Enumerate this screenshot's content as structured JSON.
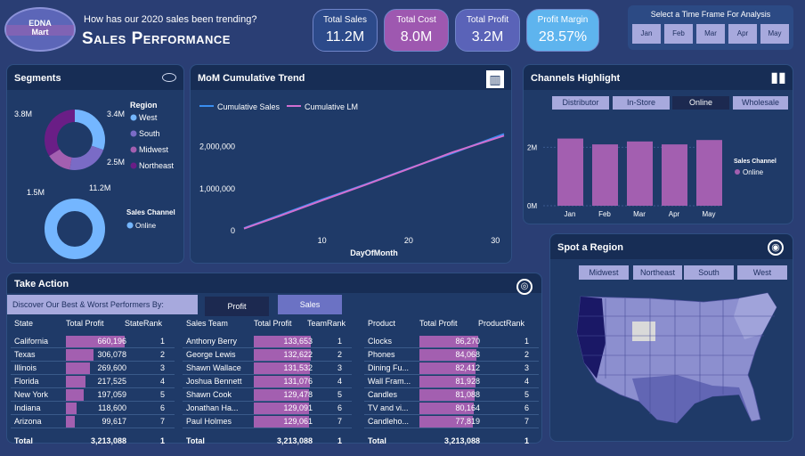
{
  "header": {
    "logo_line1": "EDNA",
    "logo_line2": "Mart",
    "question": "How has our 2020 sales been trending?",
    "title": "Sales Performance"
  },
  "kpis": [
    {
      "label": "Total Sales",
      "value": "11.2M",
      "color": "#2c4a8a"
    },
    {
      "label": "Total Cost",
      "value": "8.0M",
      "color": "#9e58b0"
    },
    {
      "label": "Total Profit",
      "value": "3.2M",
      "color": "#5a63b8"
    },
    {
      "label": "Profit Margin",
      "value": "28.57%",
      "color": "#5eb4ee"
    }
  ],
  "timeframe": {
    "title": "Select a Time Frame For Analysis",
    "months": [
      "Jan",
      "Feb",
      "Mar",
      "Apr",
      "May"
    ]
  },
  "segments": {
    "title": "Segments",
    "region_legend_title": "Region",
    "regions": [
      {
        "name": "West",
        "value": "3.4M",
        "color": "#74b6ff"
      },
      {
        "name": "South",
        "value": "2.5M",
        "color": "#7a6bc6"
      },
      {
        "name": "Midwest",
        "value": "1.5M",
        "color": "#a35fb0"
      },
      {
        "name": "Northeast",
        "value": "3.8M",
        "color": "#6a1e86"
      }
    ],
    "channel_legend_title": "Sales Channel",
    "channel_name": "Online",
    "channel_value": "11.2M"
  },
  "mom": {
    "title": "MoM Cumulative Trend",
    "legend": [
      "Cumulative Sales",
      "Cumulative LM"
    ],
    "xlabel": "DayOfMonth"
  },
  "channels": {
    "title": "Channels Highlight",
    "buttons": [
      "Distributor",
      "In-Store",
      "Online",
      "Wholesale"
    ],
    "legend_title": "Sales Channel",
    "legend_item": "Online"
  },
  "region_map": {
    "title": "Spot a Region",
    "buttons": [
      "Midwest",
      "Northeast",
      "South",
      "West"
    ]
  },
  "take_action": {
    "title": "Take Action",
    "prompt": "Discover Our Best & Worst Performers By:",
    "buttons": [
      "Profit",
      "Sales"
    ]
  },
  "state_table": {
    "headers": [
      "State",
      "Total Profit",
      "StateRank"
    ],
    "rows": [
      [
        "California",
        "660,196",
        "1"
      ],
      [
        "Texas",
        "306,078",
        "2"
      ],
      [
        "Illinois",
        "269,600",
        "3"
      ],
      [
        "Florida",
        "217,525",
        "4"
      ],
      [
        "New York",
        "197,059",
        "5"
      ],
      [
        "Indiana",
        "118,600",
        "6"
      ],
      [
        "Arizona",
        "99,617",
        "7"
      ]
    ],
    "total": [
      "Total",
      "3,213,088",
      "1"
    ]
  },
  "team_table": {
    "headers": [
      "Sales Team",
      "Total Profit",
      "TeamRank"
    ],
    "rows": [
      [
        "Anthony Berry",
        "133,653",
        "1"
      ],
      [
        "George Lewis",
        "132,622",
        "2"
      ],
      [
        "Shawn Wallace",
        "131,532",
        "3"
      ],
      [
        "Joshua Bennett",
        "131,076",
        "4"
      ],
      [
        "Shawn Cook",
        "129,478",
        "5"
      ],
      [
        "Jonathan Ha...",
        "129,091",
        "6"
      ],
      [
        "Paul Holmes",
        "129,061",
        "7"
      ]
    ],
    "total": [
      "Total",
      "3,213,088",
      "1"
    ]
  },
  "product_table": {
    "headers": [
      "Product",
      "Total Profit",
      "ProductRank"
    ],
    "rows": [
      [
        "Clocks",
        "86,270",
        "1"
      ],
      [
        "Phones",
        "84,068",
        "2"
      ],
      [
        "Dining Fu...",
        "82,412",
        "3"
      ],
      [
        "Wall Fram...",
        "81,928",
        "4"
      ],
      [
        "Candles",
        "81,088",
        "5"
      ],
      [
        "TV and vi...",
        "80,164",
        "6"
      ],
      [
        "Candleho...",
        "77,819",
        "7"
      ]
    ],
    "total": [
      "Total",
      "3,213,088",
      "1"
    ]
  },
  "chart_data": [
    {
      "type": "line",
      "title": "MoM Cumulative Trend",
      "xlabel": "DayOfMonth",
      "ylabel": "",
      "xlim": [
        1,
        31
      ],
      "ylim": [
        0,
        2500000
      ],
      "x_ticks": [
        10,
        20,
        30
      ],
      "y_ticks": [
        "0",
        "1,000,000",
        "2,000,000"
      ],
      "series": [
        {
          "name": "Cumulative Sales",
          "color": "#3a8ef0",
          "x": [
            1,
            5,
            10,
            15,
            20,
            25,
            31
          ],
          "y": [
            60000,
            360000,
            740000,
            1100000,
            1480000,
            1840000,
            2300000
          ]
        },
        {
          "name": "Cumulative LM",
          "color": "#d16fd1",
          "x": [
            1,
            5,
            10,
            15,
            20,
            25,
            31
          ],
          "y": [
            50000,
            340000,
            720000,
            1090000,
            1470000,
            1860000,
            2260000
          ]
        }
      ]
    },
    {
      "type": "bar",
      "title": "Channels Highlight",
      "categories": [
        "Jan",
        "Feb",
        "Mar",
        "Apr",
        "May"
      ],
      "series": [
        {
          "name": "Online",
          "values": [
            2.3,
            2.1,
            2.2,
            2.1,
            2.25
          ]
        }
      ],
      "y_ticks": [
        "0M",
        "2M"
      ],
      "ylim": [
        0,
        2.5
      ],
      "color": "#a35fb0"
    },
    {
      "type": "pie",
      "title": "Segments",
      "series": [
        {
          "name": "Region",
          "labels": [
            "West",
            "South",
            "Midwest",
            "Northeast"
          ],
          "values": [
            3.4,
            2.5,
            1.5,
            3.8
          ]
        },
        {
          "name": "Sales Channel",
          "labels": [
            "Online"
          ],
          "values": [
            11.2
          ]
        }
      ]
    }
  ]
}
